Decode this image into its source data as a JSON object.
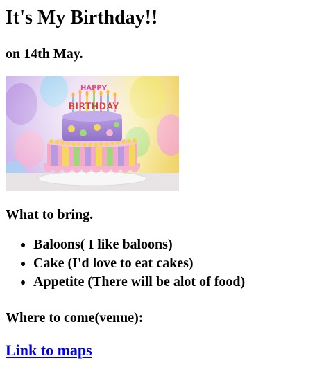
{
  "header": {
    "title": "It's My Birthday!!",
    "date_line": "on 14th May."
  },
  "image": {
    "cake_text": "HAPPY BIRTHDAY",
    "colors": {
      "background_left": "#c9b4e6",
      "background_right": "#f6e07a",
      "cake_top": "#a98bd8",
      "frosting_pink": "#f7b4d0",
      "plate": "#f2f2f2"
    }
  },
  "bring": {
    "title": "What to bring.",
    "items": [
      "Baloons( I like baloons)",
      "Cake (I'd love to eat cakes)",
      "Appetite (There will be alot of food)"
    ]
  },
  "venue": {
    "title": "Where to come(venue):",
    "link_label": "Link to maps"
  },
  "colors": {
    "link": "#0000ee",
    "text": "#000000",
    "background": "#ffffff"
  }
}
